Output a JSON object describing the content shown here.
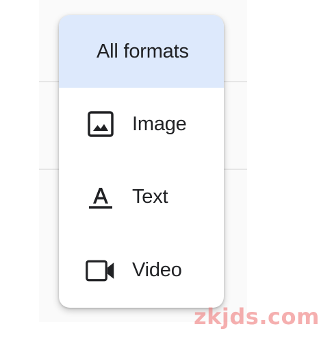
{
  "menu": {
    "items": [
      {
        "label": "All formats",
        "icon": null,
        "selected": true
      },
      {
        "label": "Image",
        "icon": "image-icon",
        "selected": false
      },
      {
        "label": "Text",
        "icon": "text-format-icon",
        "selected": false
      },
      {
        "label": "Video",
        "icon": "videocam-icon",
        "selected": false
      }
    ]
  },
  "colors": {
    "selected_background": "#dde9fc",
    "text": "#202124",
    "icon": "#202124"
  },
  "watermark": "zkjds.com"
}
